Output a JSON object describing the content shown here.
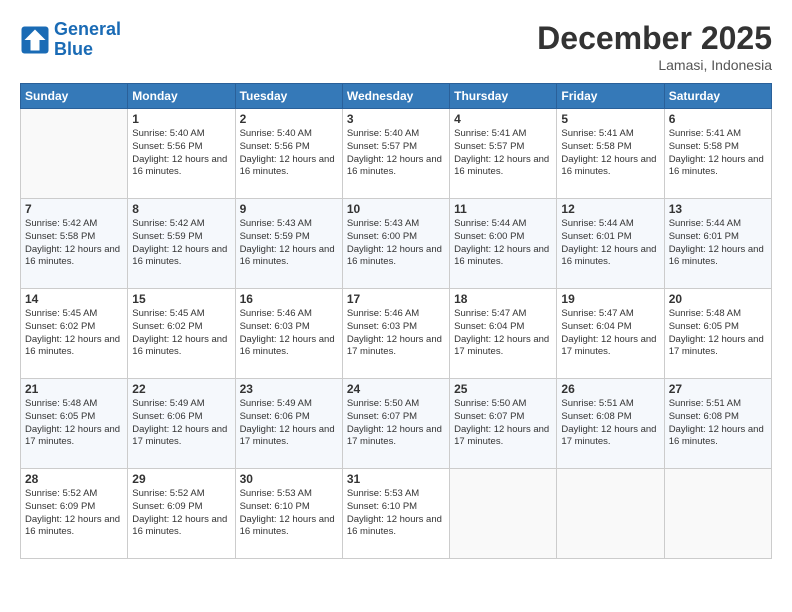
{
  "header": {
    "logo_line1": "General",
    "logo_line2": "Blue",
    "month": "December 2025",
    "location": "Lamasi, Indonesia"
  },
  "weekdays": [
    "Sunday",
    "Monday",
    "Tuesday",
    "Wednesday",
    "Thursday",
    "Friday",
    "Saturday"
  ],
  "weeks": [
    [
      {
        "day": "",
        "info": ""
      },
      {
        "day": "1",
        "info": "Sunrise: 5:40 AM\nSunset: 5:56 PM\nDaylight: 12 hours and 16 minutes."
      },
      {
        "day": "2",
        "info": "Sunrise: 5:40 AM\nSunset: 5:56 PM\nDaylight: 12 hours and 16 minutes."
      },
      {
        "day": "3",
        "info": "Sunrise: 5:40 AM\nSunset: 5:57 PM\nDaylight: 12 hours and 16 minutes."
      },
      {
        "day": "4",
        "info": "Sunrise: 5:41 AM\nSunset: 5:57 PM\nDaylight: 12 hours and 16 minutes."
      },
      {
        "day": "5",
        "info": "Sunrise: 5:41 AM\nSunset: 5:58 PM\nDaylight: 12 hours and 16 minutes."
      },
      {
        "day": "6",
        "info": "Sunrise: 5:41 AM\nSunset: 5:58 PM\nDaylight: 12 hours and 16 minutes."
      }
    ],
    [
      {
        "day": "7",
        "info": "Sunrise: 5:42 AM\nSunset: 5:58 PM\nDaylight: 12 hours and 16 minutes."
      },
      {
        "day": "8",
        "info": "Sunrise: 5:42 AM\nSunset: 5:59 PM\nDaylight: 12 hours and 16 minutes."
      },
      {
        "day": "9",
        "info": "Sunrise: 5:43 AM\nSunset: 5:59 PM\nDaylight: 12 hours and 16 minutes."
      },
      {
        "day": "10",
        "info": "Sunrise: 5:43 AM\nSunset: 6:00 PM\nDaylight: 12 hours and 16 minutes."
      },
      {
        "day": "11",
        "info": "Sunrise: 5:44 AM\nSunset: 6:00 PM\nDaylight: 12 hours and 16 minutes."
      },
      {
        "day": "12",
        "info": "Sunrise: 5:44 AM\nSunset: 6:01 PM\nDaylight: 12 hours and 16 minutes."
      },
      {
        "day": "13",
        "info": "Sunrise: 5:44 AM\nSunset: 6:01 PM\nDaylight: 12 hours and 16 minutes."
      }
    ],
    [
      {
        "day": "14",
        "info": "Sunrise: 5:45 AM\nSunset: 6:02 PM\nDaylight: 12 hours and 16 minutes."
      },
      {
        "day": "15",
        "info": "Sunrise: 5:45 AM\nSunset: 6:02 PM\nDaylight: 12 hours and 16 minutes."
      },
      {
        "day": "16",
        "info": "Sunrise: 5:46 AM\nSunset: 6:03 PM\nDaylight: 12 hours and 16 minutes."
      },
      {
        "day": "17",
        "info": "Sunrise: 5:46 AM\nSunset: 6:03 PM\nDaylight: 12 hours and 17 minutes."
      },
      {
        "day": "18",
        "info": "Sunrise: 5:47 AM\nSunset: 6:04 PM\nDaylight: 12 hours and 17 minutes."
      },
      {
        "day": "19",
        "info": "Sunrise: 5:47 AM\nSunset: 6:04 PM\nDaylight: 12 hours and 17 minutes."
      },
      {
        "day": "20",
        "info": "Sunrise: 5:48 AM\nSunset: 6:05 PM\nDaylight: 12 hours and 17 minutes."
      }
    ],
    [
      {
        "day": "21",
        "info": "Sunrise: 5:48 AM\nSunset: 6:05 PM\nDaylight: 12 hours and 17 minutes."
      },
      {
        "day": "22",
        "info": "Sunrise: 5:49 AM\nSunset: 6:06 PM\nDaylight: 12 hours and 17 minutes."
      },
      {
        "day": "23",
        "info": "Sunrise: 5:49 AM\nSunset: 6:06 PM\nDaylight: 12 hours and 17 minutes."
      },
      {
        "day": "24",
        "info": "Sunrise: 5:50 AM\nSunset: 6:07 PM\nDaylight: 12 hours and 17 minutes."
      },
      {
        "day": "25",
        "info": "Sunrise: 5:50 AM\nSunset: 6:07 PM\nDaylight: 12 hours and 17 minutes."
      },
      {
        "day": "26",
        "info": "Sunrise: 5:51 AM\nSunset: 6:08 PM\nDaylight: 12 hours and 17 minutes."
      },
      {
        "day": "27",
        "info": "Sunrise: 5:51 AM\nSunset: 6:08 PM\nDaylight: 12 hours and 16 minutes."
      }
    ],
    [
      {
        "day": "28",
        "info": "Sunrise: 5:52 AM\nSunset: 6:09 PM\nDaylight: 12 hours and 16 minutes."
      },
      {
        "day": "29",
        "info": "Sunrise: 5:52 AM\nSunset: 6:09 PM\nDaylight: 12 hours and 16 minutes."
      },
      {
        "day": "30",
        "info": "Sunrise: 5:53 AM\nSunset: 6:10 PM\nDaylight: 12 hours and 16 minutes."
      },
      {
        "day": "31",
        "info": "Sunrise: 5:53 AM\nSunset: 6:10 PM\nDaylight: 12 hours and 16 minutes."
      },
      {
        "day": "",
        "info": ""
      },
      {
        "day": "",
        "info": ""
      },
      {
        "day": "",
        "info": ""
      }
    ]
  ]
}
